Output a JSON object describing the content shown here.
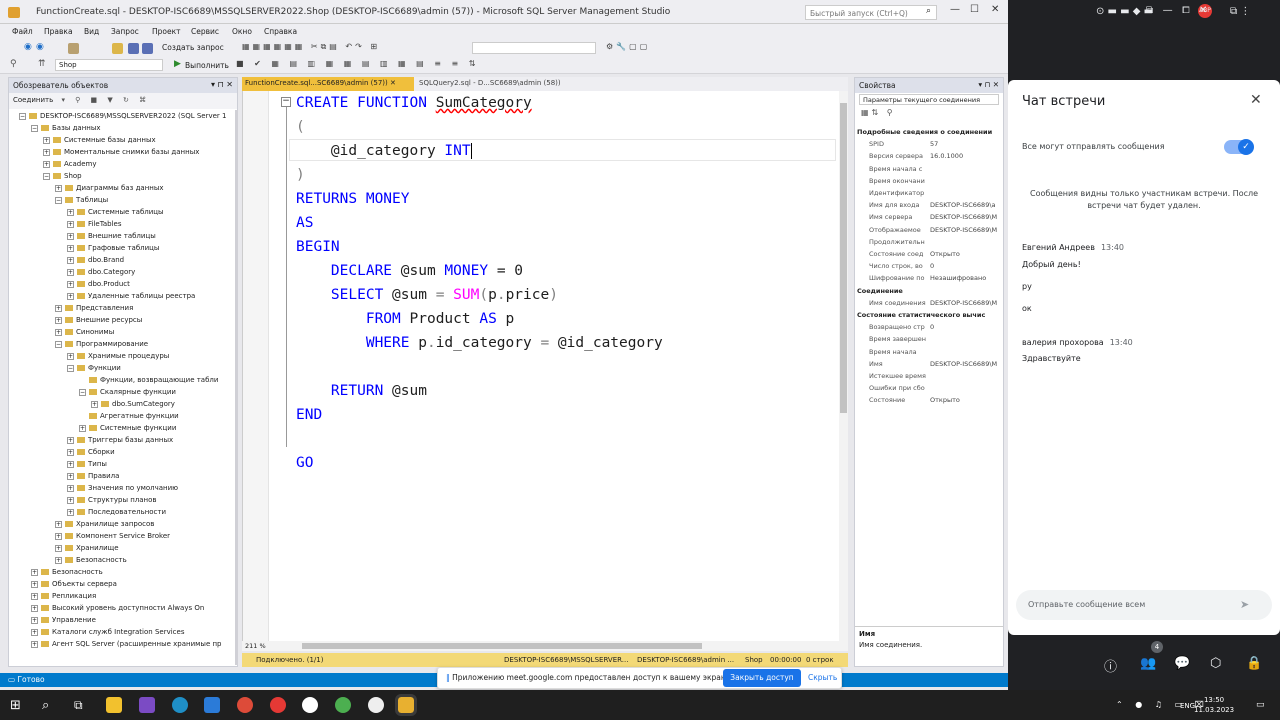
{
  "window": {
    "title": "FunctionCreate.sql - DESKTOP-ISC6689\\MSSQLSERVER2022.Shop (DESKTOP-ISC6689\\admin (57)) - Microsoft SQL Server Management Studio",
    "quick_launch": "Быстрый запуск (Ctrl+Q)"
  },
  "menu": [
    "Файл",
    "Правка",
    "Вид",
    "Запрос",
    "Проект",
    "Сервис",
    "Окно",
    "Справка"
  ],
  "toolbar": {
    "new_query": "Создать запрос",
    "db": "Shop",
    "execute": "Выполнить"
  },
  "object_explorer": {
    "title": "Обозреватель объектов",
    "connect": "Соединить",
    "nodes": [
      {
        "t": "DESKTOP-ISC6689\\MSSQLSERVER2022 (SQL Server 1",
        "d": 0,
        "e": "-"
      },
      {
        "t": "Базы данных",
        "d": 1,
        "e": "-"
      },
      {
        "t": "Системные базы данных",
        "d": 2,
        "e": "+"
      },
      {
        "t": "Моментальные снимки базы данных",
        "d": 2,
        "e": "+"
      },
      {
        "t": "Academy",
        "d": 2,
        "e": "+"
      },
      {
        "t": "Shop",
        "d": 2,
        "e": "-"
      },
      {
        "t": "Диаграммы баз данных",
        "d": 3,
        "e": "+"
      },
      {
        "t": "Таблицы",
        "d": 3,
        "e": "-"
      },
      {
        "t": "Системные таблицы",
        "d": 4,
        "e": "+"
      },
      {
        "t": "FileTables",
        "d": 4,
        "e": "+"
      },
      {
        "t": "Внешние таблицы",
        "d": 4,
        "e": "+"
      },
      {
        "t": "Графовые таблицы",
        "d": 4,
        "e": "+"
      },
      {
        "t": "dbo.Brand",
        "d": 4,
        "e": "+"
      },
      {
        "t": "dbo.Category",
        "d": 4,
        "e": "+"
      },
      {
        "t": "dbo.Product",
        "d": 4,
        "e": "+"
      },
      {
        "t": "Удаленные таблицы реестра",
        "d": 4,
        "e": "+"
      },
      {
        "t": "Представления",
        "d": 3,
        "e": "+"
      },
      {
        "t": "Внешние ресурсы",
        "d": 3,
        "e": "+"
      },
      {
        "t": "Синонимы",
        "d": 3,
        "e": "+"
      },
      {
        "t": "Программирование",
        "d": 3,
        "e": "-"
      },
      {
        "t": "Хранимые процедуры",
        "d": 4,
        "e": "+"
      },
      {
        "t": "Функции",
        "d": 4,
        "e": "-"
      },
      {
        "t": "Функции, возвращающие табли",
        "d": 5,
        "e": ""
      },
      {
        "t": "Скалярные функции",
        "d": 5,
        "e": "-"
      },
      {
        "t": "dbo.SumCategory",
        "d": 6,
        "e": "+"
      },
      {
        "t": "Агрегатные функции",
        "d": 5,
        "e": ""
      },
      {
        "t": "Системные функции",
        "d": 5,
        "e": "+"
      },
      {
        "t": "Триггеры базы данных",
        "d": 4,
        "e": "+"
      },
      {
        "t": "Сборки",
        "d": 4,
        "e": "+"
      },
      {
        "t": "Типы",
        "d": 4,
        "e": "+"
      },
      {
        "t": "Правила",
        "d": 4,
        "e": "+"
      },
      {
        "t": "Значения по умолчанию",
        "d": 4,
        "e": "+"
      },
      {
        "t": "Структуры планов",
        "d": 4,
        "e": "+"
      },
      {
        "t": "Последовательности",
        "d": 4,
        "e": "+"
      },
      {
        "t": "Хранилище запросов",
        "d": 3,
        "e": "+"
      },
      {
        "t": "Компонент Service Broker",
        "d": 3,
        "e": "+"
      },
      {
        "t": "Хранилище",
        "d": 3,
        "e": "+"
      },
      {
        "t": "Безопасность",
        "d": 3,
        "e": "+"
      },
      {
        "t": "Безопасность",
        "d": 1,
        "e": "+"
      },
      {
        "t": "Объекты сервера",
        "d": 1,
        "e": "+"
      },
      {
        "t": "Репликация",
        "d": 1,
        "e": "+"
      },
      {
        "t": "Высокий уровень доступности Always On",
        "d": 1,
        "e": "+"
      },
      {
        "t": "Управление",
        "d": 1,
        "e": "+"
      },
      {
        "t": "Каталоги служб Integration Services",
        "d": 1,
        "e": "+"
      },
      {
        "t": "Агент SQL Server (расширенные хранимые пр",
        "d": 1,
        "e": "+"
      }
    ]
  },
  "tabs": {
    "active": "FunctionCreate.sql...SC6689\\admin (57))",
    "other": "SQLQuery2.sql - D...SC6689\\admin (58))"
  },
  "code": {
    "l1_a": "CREATE FUNCTION ",
    "l1_b": "SumCategory",
    "l2": "(",
    "l3_a": "    @id_category ",
    "l3_b": "INT",
    "l4": ")",
    "l5": "RETURNS MONEY",
    "l6": "AS",
    "l7": "BEGIN",
    "l8_a": "    DECLARE ",
    "l8_b": "@sum ",
    "l8_c": "MONEY ",
    "l8_d": "= 0",
    "l9_a": "    SELECT ",
    "l9_b": "@sum ",
    "l9_c": "= ",
    "l9_d": "SUM",
    "l9_e": "(",
    "l9_f": "p",
    "l9_g": ".",
    "l9_h": "price",
    "l9_i": ")",
    "l10_a": "        FROM ",
    "l10_b": "Product ",
    "l10_c": "AS ",
    "l10_d": "p",
    "l11_a": "        WHERE ",
    "l11_b": "p",
    "l11_c": ".",
    "l11_d": "id_category ",
    "l11_e": "= ",
    "l11_f": "@id_category",
    "l12_a": "    RETURN ",
    "l12_b": "@sum",
    "l13": "END",
    "l14": "GO"
  },
  "editor_status": {
    "zoom": "211 %",
    "connected": "Подключено. (1/1)",
    "server": "DESKTOP-ISC6689\\MSSQLSERVER...",
    "user": "DESKTOP-ISC6689\\admin ...",
    "db": "Shop",
    "time": "00:00:00",
    "rows": "0 строк"
  },
  "properties": {
    "title": "Свойства",
    "subtitle": "Параметры текущего соединения",
    "rows": [
      {
        "k": "Подробные сведения о соединении",
        "v": "",
        "h": true
      },
      {
        "k": "SPID",
        "v": "57"
      },
      {
        "k": "Версия сервера",
        "v": "16.0.1000"
      },
      {
        "k": "Время начала с",
        "v": ""
      },
      {
        "k": "Время окончани",
        "v": ""
      },
      {
        "k": "Идентификатор",
        "v": ""
      },
      {
        "k": "Имя для входа",
        "v": "DESKTOP-ISC6689\\a"
      },
      {
        "k": "Имя сервера",
        "v": "DESKTOP-ISC6689\\M"
      },
      {
        "k": "Отображаемое",
        "v": "DESKTOP-ISC6689\\M"
      },
      {
        "k": "Продолжительн",
        "v": ""
      },
      {
        "k": "Состояние соед",
        "v": "Открыто"
      },
      {
        "k": "Число строк, во",
        "v": "0"
      },
      {
        "k": "Шифрование по",
        "v": "Незашифровано"
      },
      {
        "k": "Соединение",
        "v": "",
        "h": true
      },
      {
        "k": "Имя соединения",
        "v": "DESKTOP-ISC6689\\M"
      },
      {
        "k": "Состояние статистического вычис",
        "v": "",
        "h": true
      },
      {
        "k": "Возвращено стр",
        "v": "0"
      },
      {
        "k": "Время завершен",
        "v": ""
      },
      {
        "k": "Время начала",
        "v": ""
      },
      {
        "k": "Имя",
        "v": "DESKTOP-ISC6689\\M"
      },
      {
        "k": "Истекшее время",
        "v": ""
      },
      {
        "k": "Ошибки при сбо",
        "v": ""
      },
      {
        "k": "Состояние",
        "v": "Открыто"
      }
    ],
    "desc_title": "Имя",
    "desc_text": "Имя соединения."
  },
  "statusbar": {
    "text": "Готово"
  },
  "share": {
    "text": "Приложению meet.google.com предоставлен доступ к вашему экрану.",
    "stop": "Закрыть доступ",
    "hide": "Скрыть"
  },
  "chat": {
    "title": "Чат встречи",
    "allow": "Все могут отправлять сообщения",
    "notice": "Сообщения видны только участникам встречи. После встречи чат будет удален.",
    "messages": [
      {
        "author": "Евгений Андреев",
        "time": "13:40",
        "lines": [
          "Добрый день!",
          "ру",
          "ок"
        ]
      },
      {
        "author": "валерия прохорова",
        "time": "13:40",
        "lines": [
          "Здравствуйте"
        ]
      }
    ],
    "input_placeholder": "Отправьте сообщение всем",
    "badge": "4"
  },
  "taskbar": {
    "lang": "ENG",
    "time": "13:50",
    "date": "11.03.2023"
  }
}
